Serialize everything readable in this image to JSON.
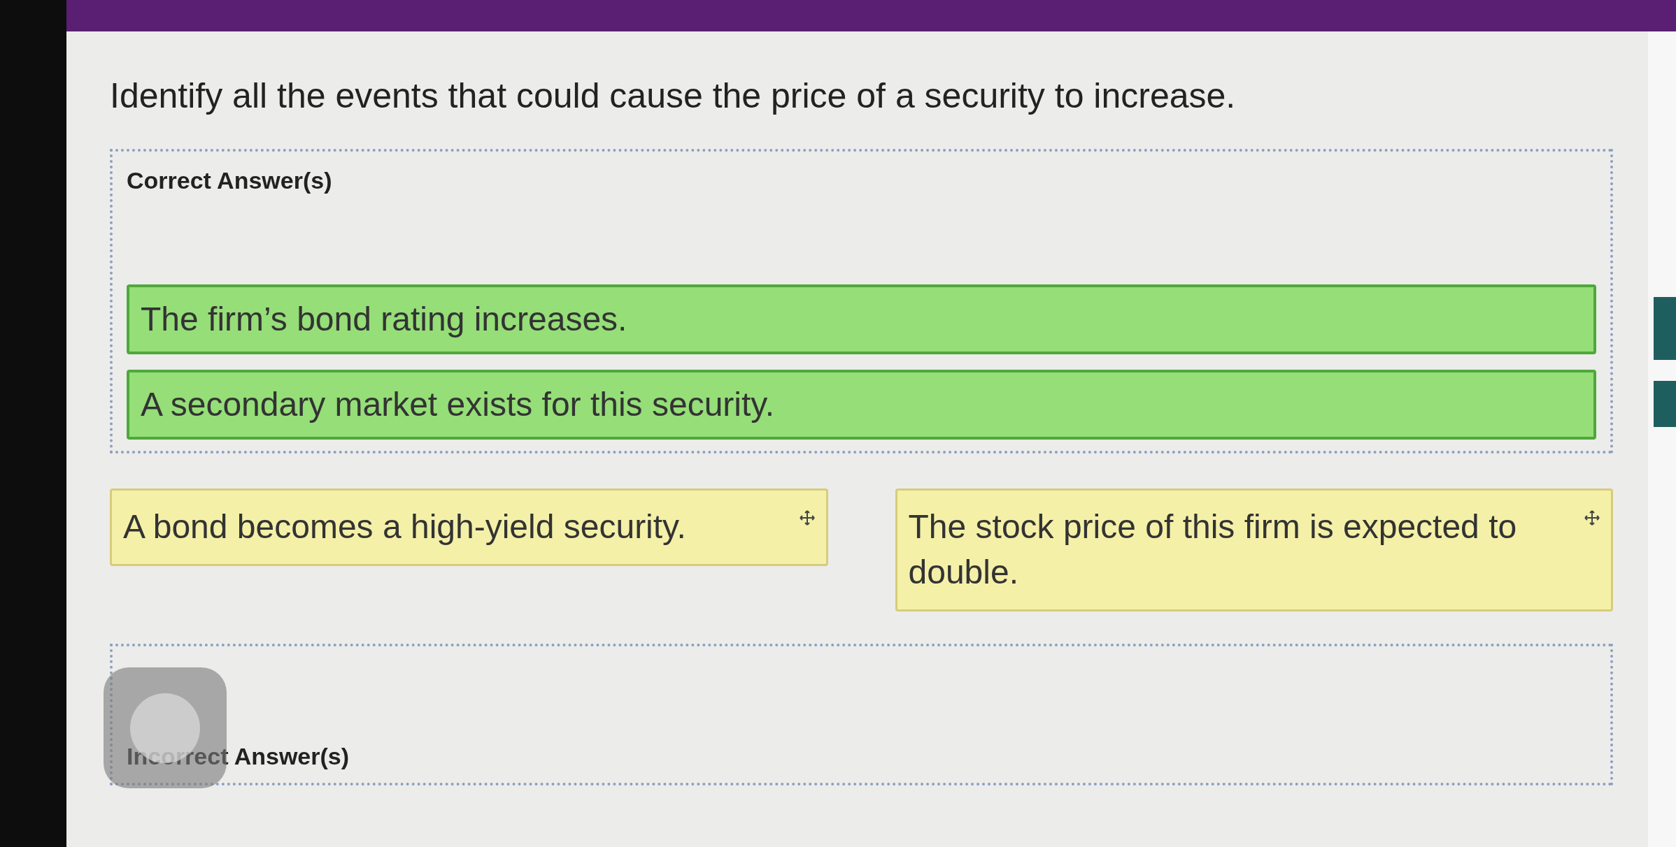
{
  "question": "Identify all the events that could cause the price of a security to increase.",
  "correct_zone": {
    "kind": "correct",
    "label": "Correct Answer(s)",
    "items": [
      "The firm’s bond rating increases.",
      "A secondary market exists for this security."
    ]
  },
  "unplaced_items": [
    "A bond becomes a high-yield security.",
    "The stock price of this firm is expected to double."
  ],
  "incorrect_zone": {
    "kind": "incorrect",
    "label": "Incorrect Answer(s)"
  }
}
